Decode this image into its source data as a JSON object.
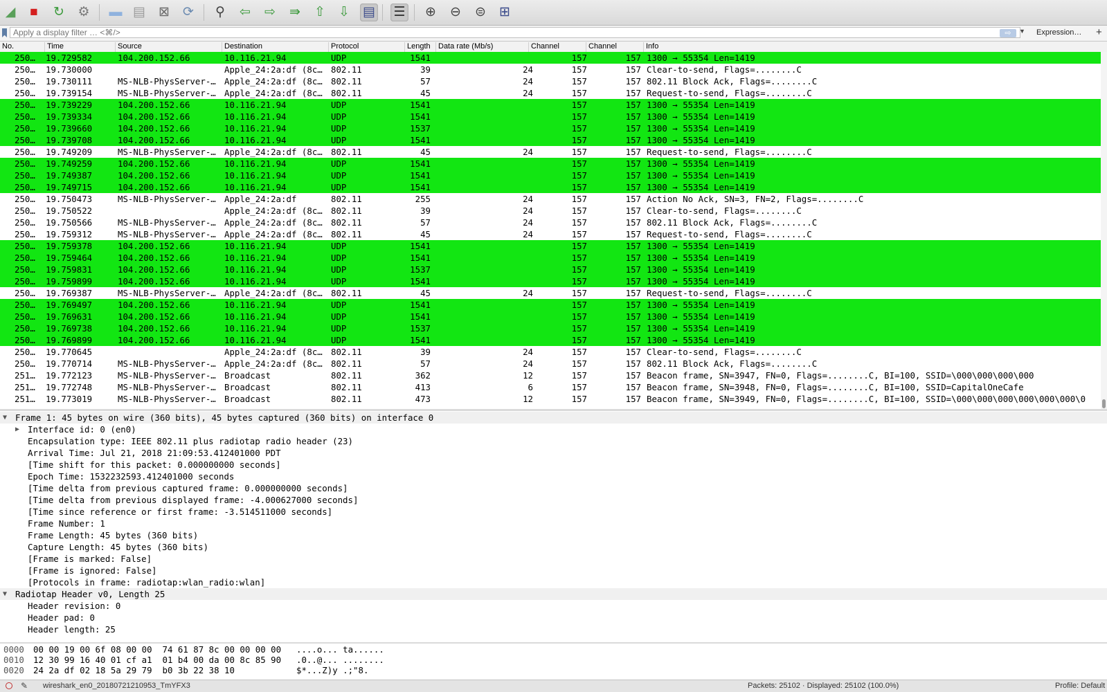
{
  "toolbar": {
    "icons": [
      {
        "name": "shark-fin-start-icon",
        "glyph": "◢",
        "color": "#5aa05a"
      },
      {
        "name": "stop-capture-icon",
        "glyph": "■",
        "color": "#d41f1f"
      },
      {
        "name": "restart-capture-icon",
        "glyph": "↻",
        "color": "#3a9a3a"
      },
      {
        "name": "capture-options-icon",
        "glyph": "⚙",
        "color": "#7a7a7a"
      },
      {
        "name": "open-file-icon",
        "glyph": "▬",
        "color": "#8fb2de"
      },
      {
        "name": "save-file-icon",
        "glyph": "▤",
        "color": "#9a9a9a"
      },
      {
        "name": "close-file-icon",
        "glyph": "⊠",
        "color": "#6a6a6a"
      },
      {
        "name": "reload-file-icon",
        "glyph": "⟳",
        "color": "#6a8ab0"
      },
      {
        "name": "find-packet-icon",
        "glyph": "⚲",
        "color": "#444444"
      },
      {
        "name": "go-back-icon",
        "glyph": "⇦",
        "color": "#3c9a3c"
      },
      {
        "name": "go-forward-icon",
        "glyph": "⇨",
        "color": "#3c9a3c"
      },
      {
        "name": "go-to-packet-icon",
        "glyph": "⇛",
        "color": "#3c9a3c"
      },
      {
        "name": "first-packet-icon",
        "glyph": "⇧",
        "color": "#3c9a3c"
      },
      {
        "name": "last-packet-icon",
        "glyph": "⇩",
        "color": "#3c9a3c"
      },
      {
        "name": "autoscroll-icon",
        "glyph": "▤",
        "color": "#3a4a8a"
      },
      {
        "name": "colorize-icon",
        "glyph": "☰",
        "color": "#333333"
      },
      {
        "name": "zoom-in-icon",
        "glyph": "⊕",
        "color": "#444444"
      },
      {
        "name": "zoom-out-icon",
        "glyph": "⊖",
        "color": "#444444"
      },
      {
        "name": "zoom-normal-icon",
        "glyph": "⊜",
        "color": "#444444"
      },
      {
        "name": "resize-columns-icon",
        "glyph": "⊞",
        "color": "#3a4a8a"
      }
    ]
  },
  "filter": {
    "placeholder": "Apply a display filter … <⌘/>",
    "apply_glyph": "⇨",
    "dropdown_glyph": "▼",
    "expression_label": "Expression…",
    "add_label": "+"
  },
  "packet_list": {
    "columns": [
      "No.",
      "Time",
      "Source",
      "Destination",
      "Protocol",
      "Length",
      "Data rate (Mb/s)",
      "Channel",
      "Channel",
      "Info"
    ],
    "rows": [
      {
        "no": "250…",
        "time": "19.729582",
        "src": "104.200.152.66",
        "dst": "10.116.21.94",
        "proto": "UDP",
        "len": "1541",
        "rate": "",
        "ch1": "157",
        "ch2": "157",
        "info": "1300 → 55354 Len=1419",
        "type": "udp"
      },
      {
        "no": "250…",
        "time": "19.730000",
        "src": "",
        "dst": "Apple_24:2a:df (8c…",
        "proto": "802.11",
        "len": "39",
        "rate": "24",
        "ch1": "157",
        "ch2": "157",
        "info": "Clear-to-send, Flags=........C",
        "type": "wlan"
      },
      {
        "no": "250…",
        "time": "19.730111",
        "src": "MS-NLB-PhysServer-…",
        "dst": "Apple_24:2a:df (8c…",
        "proto": "802.11",
        "len": "57",
        "rate": "24",
        "ch1": "157",
        "ch2": "157",
        "info": "802.11 Block Ack, Flags=........C",
        "type": "wlan"
      },
      {
        "no": "250…",
        "time": "19.739154",
        "src": "MS-NLB-PhysServer-…",
        "dst": "Apple_24:2a:df (8c…",
        "proto": "802.11",
        "len": "45",
        "rate": "24",
        "ch1": "157",
        "ch2": "157",
        "info": "Request-to-send, Flags=........C",
        "type": "wlan"
      },
      {
        "no": "250…",
        "time": "19.739229",
        "src": "104.200.152.66",
        "dst": "10.116.21.94",
        "proto": "UDP",
        "len": "1541",
        "rate": "",
        "ch1": "157",
        "ch2": "157",
        "info": "1300 → 55354 Len=1419",
        "type": "udp"
      },
      {
        "no": "250…",
        "time": "19.739334",
        "src": "104.200.152.66",
        "dst": "10.116.21.94",
        "proto": "UDP",
        "len": "1541",
        "rate": "",
        "ch1": "157",
        "ch2": "157",
        "info": "1300 → 55354 Len=1419",
        "type": "udp"
      },
      {
        "no": "250…",
        "time": "19.739660",
        "src": "104.200.152.66",
        "dst": "10.116.21.94",
        "proto": "UDP",
        "len": "1537",
        "rate": "",
        "ch1": "157",
        "ch2": "157",
        "info": "1300 → 55354 Len=1419",
        "type": "udp"
      },
      {
        "no": "250…",
        "time": "19.739708",
        "src": "104.200.152.66",
        "dst": "10.116.21.94",
        "proto": "UDP",
        "len": "1541",
        "rate": "",
        "ch1": "157",
        "ch2": "157",
        "info": "1300 → 55354 Len=1419",
        "type": "udp"
      },
      {
        "no": "250…",
        "time": "19.749209",
        "src": "MS-NLB-PhysServer-…",
        "dst": "Apple_24:2a:df (8c…",
        "proto": "802.11",
        "len": "45",
        "rate": "24",
        "ch1": "157",
        "ch2": "157",
        "info": "Request-to-send, Flags=........C",
        "type": "wlan"
      },
      {
        "no": "250…",
        "time": "19.749259",
        "src": "104.200.152.66",
        "dst": "10.116.21.94",
        "proto": "UDP",
        "len": "1541",
        "rate": "",
        "ch1": "157",
        "ch2": "157",
        "info": "1300 → 55354 Len=1419",
        "type": "udp"
      },
      {
        "no": "250…",
        "time": "19.749387",
        "src": "104.200.152.66",
        "dst": "10.116.21.94",
        "proto": "UDP",
        "len": "1541",
        "rate": "",
        "ch1": "157",
        "ch2": "157",
        "info": "1300 → 55354 Len=1419",
        "type": "udp"
      },
      {
        "no": "250…",
        "time": "19.749715",
        "src": "104.200.152.66",
        "dst": "10.116.21.94",
        "proto": "UDP",
        "len": "1541",
        "rate": "",
        "ch1": "157",
        "ch2": "157",
        "info": "1300 → 55354 Len=1419",
        "type": "udp"
      },
      {
        "no": "250…",
        "time": "19.750473",
        "src": "MS-NLB-PhysServer-…",
        "dst": "Apple_24:2a:df",
        "proto": "802.11",
        "len": "255",
        "rate": "24",
        "ch1": "157",
        "ch2": "157",
        "info": "Action No Ack, SN=3, FN=2, Flags=........C",
        "type": "wlan"
      },
      {
        "no": "250…",
        "time": "19.750522",
        "src": "",
        "dst": "Apple_24:2a:df (8c…",
        "proto": "802.11",
        "len": "39",
        "rate": "24",
        "ch1": "157",
        "ch2": "157",
        "info": "Clear-to-send, Flags=........C",
        "type": "wlan"
      },
      {
        "no": "250…",
        "time": "19.750566",
        "src": "MS-NLB-PhysServer-…",
        "dst": "Apple_24:2a:df (8c…",
        "proto": "802.11",
        "len": "57",
        "rate": "24",
        "ch1": "157",
        "ch2": "157",
        "info": "802.11 Block Ack, Flags=........C",
        "type": "wlan"
      },
      {
        "no": "250…",
        "time": "19.759312",
        "src": "MS-NLB-PhysServer-…",
        "dst": "Apple_24:2a:df (8c…",
        "proto": "802.11",
        "len": "45",
        "rate": "24",
        "ch1": "157",
        "ch2": "157",
        "info": "Request-to-send, Flags=........C",
        "type": "wlan"
      },
      {
        "no": "250…",
        "time": "19.759378",
        "src": "104.200.152.66",
        "dst": "10.116.21.94",
        "proto": "UDP",
        "len": "1541",
        "rate": "",
        "ch1": "157",
        "ch2": "157",
        "info": "1300 → 55354 Len=1419",
        "type": "udp"
      },
      {
        "no": "250…",
        "time": "19.759464",
        "src": "104.200.152.66",
        "dst": "10.116.21.94",
        "proto": "UDP",
        "len": "1541",
        "rate": "",
        "ch1": "157",
        "ch2": "157",
        "info": "1300 → 55354 Len=1419",
        "type": "udp"
      },
      {
        "no": "250…",
        "time": "19.759831",
        "src": "104.200.152.66",
        "dst": "10.116.21.94",
        "proto": "UDP",
        "len": "1537",
        "rate": "",
        "ch1": "157",
        "ch2": "157",
        "info": "1300 → 55354 Len=1419",
        "type": "udp"
      },
      {
        "no": "250…",
        "time": "19.759899",
        "src": "104.200.152.66",
        "dst": "10.116.21.94",
        "proto": "UDP",
        "len": "1541",
        "rate": "",
        "ch1": "157",
        "ch2": "157",
        "info": "1300 → 55354 Len=1419",
        "type": "udp"
      },
      {
        "no": "250…",
        "time": "19.769387",
        "src": "MS-NLB-PhysServer-…",
        "dst": "Apple_24:2a:df (8c…",
        "proto": "802.11",
        "len": "45",
        "rate": "24",
        "ch1": "157",
        "ch2": "157",
        "info": "Request-to-send, Flags=........C",
        "type": "wlan"
      },
      {
        "no": "250…",
        "time": "19.769497",
        "src": "104.200.152.66",
        "dst": "10.116.21.94",
        "proto": "UDP",
        "len": "1541",
        "rate": "",
        "ch1": "157",
        "ch2": "157",
        "info": "1300 → 55354 Len=1419",
        "type": "udp"
      },
      {
        "no": "250…",
        "time": "19.769631",
        "src": "104.200.152.66",
        "dst": "10.116.21.94",
        "proto": "UDP",
        "len": "1541",
        "rate": "",
        "ch1": "157",
        "ch2": "157",
        "info": "1300 → 55354 Len=1419",
        "type": "udp"
      },
      {
        "no": "250…",
        "time": "19.769738",
        "src": "104.200.152.66",
        "dst": "10.116.21.94",
        "proto": "UDP",
        "len": "1537",
        "rate": "",
        "ch1": "157",
        "ch2": "157",
        "info": "1300 → 55354 Len=1419",
        "type": "udp"
      },
      {
        "no": "250…",
        "time": "19.769899",
        "src": "104.200.152.66",
        "dst": "10.116.21.94",
        "proto": "UDP",
        "len": "1541",
        "rate": "",
        "ch1": "157",
        "ch2": "157",
        "info": "1300 → 55354 Len=1419",
        "type": "udp"
      },
      {
        "no": "250…",
        "time": "19.770645",
        "src": "",
        "dst": "Apple_24:2a:df (8c…",
        "proto": "802.11",
        "len": "39",
        "rate": "24",
        "ch1": "157",
        "ch2": "157",
        "info": "Clear-to-send, Flags=........C",
        "type": "wlan"
      },
      {
        "no": "250…",
        "time": "19.770714",
        "src": "MS-NLB-PhysServer-…",
        "dst": "Apple_24:2a:df (8c…",
        "proto": "802.11",
        "len": "57",
        "rate": "24",
        "ch1": "157",
        "ch2": "157",
        "info": "802.11 Block Ack, Flags=........C",
        "type": "wlan"
      },
      {
        "no": "251…",
        "time": "19.772123",
        "src": "MS-NLB-PhysServer-…",
        "dst": "Broadcast",
        "proto": "802.11",
        "len": "362",
        "rate": "12",
        "ch1": "157",
        "ch2": "157",
        "info": "Beacon frame, SN=3947, FN=0, Flags=........C, BI=100, SSID=\\000\\000\\000\\000",
        "type": "wlan"
      },
      {
        "no": "251…",
        "time": "19.772748",
        "src": "MS-NLB-PhysServer-…",
        "dst": "Broadcast",
        "proto": "802.11",
        "len": "413",
        "rate": "6",
        "ch1": "157",
        "ch2": "157",
        "info": "Beacon frame, SN=3948, FN=0, Flags=........C, BI=100, SSID=CapitalOneCafe",
        "type": "wlan"
      },
      {
        "no": "251…",
        "time": "19.773019",
        "src": "MS-NLB-PhysServer-…",
        "dst": "Broadcast",
        "proto": "802.11",
        "len": "473",
        "rate": "12",
        "ch1": "157",
        "ch2": "157",
        "info": "Beacon frame, SN=3949, FN=0, Flags=........C, BI=100, SSID=\\000\\000\\000\\000\\000\\000\\0",
        "type": "wlan"
      }
    ]
  },
  "details": {
    "expanded_glyph": "▼",
    "collapsed_glyph": "▶",
    "rows": [
      {
        "text": "Frame 1: 45 bytes on wire (360 bits), 45 bytes captured (360 bits) on interface 0",
        "level": 0,
        "twisty": "expanded",
        "section": true
      },
      {
        "text": "Interface id: 0 (en0)",
        "level": 1,
        "twisty": "collapsed",
        "section": false
      },
      {
        "text": "Encapsulation type: IEEE 802.11 plus radiotap radio header (23)",
        "level": 1,
        "twisty": "",
        "section": false
      },
      {
        "text": "Arrival Time: Jul 21, 2018 21:09:53.412401000 PDT",
        "level": 1,
        "twisty": "",
        "section": false
      },
      {
        "text": "[Time shift for this packet: 0.000000000 seconds]",
        "level": 1,
        "twisty": "",
        "section": false
      },
      {
        "text": "Epoch Time: 1532232593.412401000 seconds",
        "level": 1,
        "twisty": "",
        "section": false
      },
      {
        "text": "[Time delta from previous captured frame: 0.000000000 seconds]",
        "level": 1,
        "twisty": "",
        "section": false
      },
      {
        "text": "[Time delta from previous displayed frame: -4.000627000 seconds]",
        "level": 1,
        "twisty": "",
        "section": false
      },
      {
        "text": "[Time since reference or first frame: -3.514511000 seconds]",
        "level": 1,
        "twisty": "",
        "section": false
      },
      {
        "text": "Frame Number: 1",
        "level": 1,
        "twisty": "",
        "section": false
      },
      {
        "text": "Frame Length: 45 bytes (360 bits)",
        "level": 1,
        "twisty": "",
        "section": false
      },
      {
        "text": "Capture Length: 45 bytes (360 bits)",
        "level": 1,
        "twisty": "",
        "section": false
      },
      {
        "text": "[Frame is marked: False]",
        "level": 1,
        "twisty": "",
        "section": false
      },
      {
        "text": "[Frame is ignored: False]",
        "level": 1,
        "twisty": "",
        "section": false
      },
      {
        "text": "[Protocols in frame: radiotap:wlan_radio:wlan]",
        "level": 1,
        "twisty": "",
        "section": false
      },
      {
        "text": "Radiotap Header v0, Length 25",
        "level": 0,
        "twisty": "expanded",
        "section": true
      },
      {
        "text": "Header revision: 0",
        "level": 1,
        "twisty": "",
        "section": false
      },
      {
        "text": "Header pad: 0",
        "level": 1,
        "twisty": "",
        "section": false
      },
      {
        "text": "Header length: 25",
        "level": 1,
        "twisty": "",
        "section": false
      }
    ]
  },
  "bytes": {
    "rows": [
      {
        "offset": "0000",
        "hex": "00 00 19 00 6f 08 00 00  74 61 87 8c 00 00 00 00",
        "ascii": "....o... ta......"
      },
      {
        "offset": "0010",
        "hex": "12 30 99 16 40 01 cf a1  01 b4 00 da 00 8c 85 90",
        "ascii": ".0..@... ........"
      },
      {
        "offset": "0020",
        "hex": "24 2a df 02 18 5a 29 79  b0 3b 22 38 10",
        "ascii": "$*...Z)y .;\"8."
      }
    ]
  },
  "status": {
    "file": "wireshark_en0_20180721210953_TmYFX3",
    "packets": "Packets: 25102 · Displayed: 25102 (100.0%)",
    "profile": "Profile: Default",
    "edit_glyph": "✎"
  },
  "colors": {
    "udp_row": "#12e612",
    "wlan_row": "#ffffff",
    "section_row": "#f0f0f0"
  }
}
